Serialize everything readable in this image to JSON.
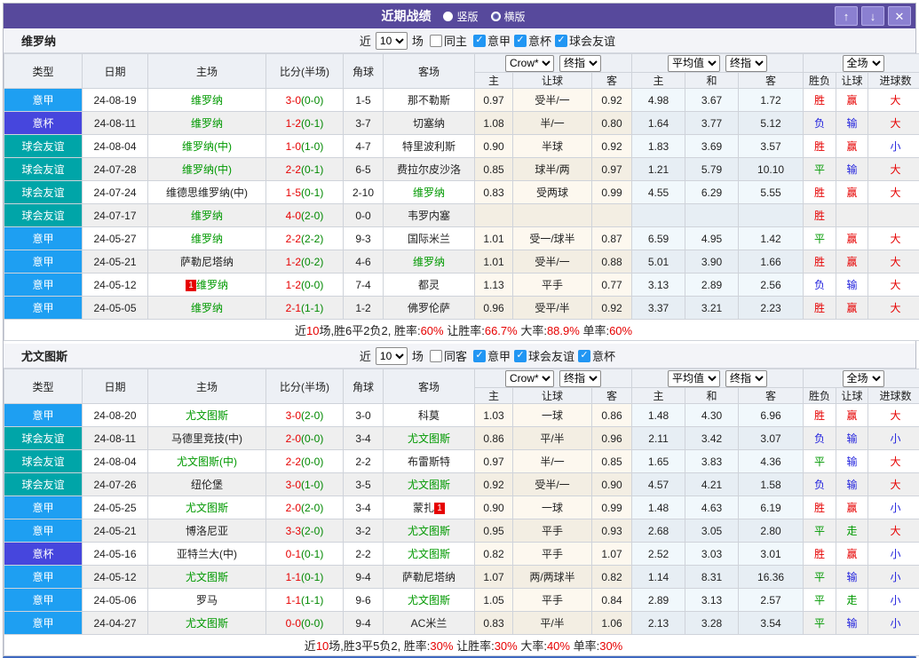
{
  "colors": {
    "league": {
      "意甲": "#1e9ff2",
      "意杯": "#4646dd",
      "球会友谊": "#00a5a8"
    },
    "result": {
      "r": "#e60000",
      "g": "#009900",
      "b": "#2323dd"
    },
    "titlebar": "#57499c",
    "team_highlight": "#009900",
    "score_fulltime": "#e60000",
    "score_halftime": "#008800",
    "checkbox_checked": "#2196f3"
  },
  "title_bar": {
    "title": "近期战绩",
    "view_options": [
      {
        "label": "竖版",
        "selected": true
      },
      {
        "label": "横版",
        "selected": false
      }
    ],
    "buttons": {
      "up": "↑",
      "down": "↓",
      "close": "✕"
    }
  },
  "columns": {
    "main": [
      "类型",
      "日期",
      "主场",
      "比分(半场)",
      "角球",
      "客场"
    ],
    "selects": [
      "Crow*",
      "终指",
      "平均值",
      "终指",
      "全场"
    ],
    "sub": [
      "主",
      "让球",
      "客",
      "主",
      "和",
      "客",
      "胜负",
      "让球",
      "进球数"
    ]
  },
  "sections": [
    {
      "team": "维罗纳",
      "filter": {
        "near_label": "近",
        "matches_value": "10",
        "matches_suffix": "场",
        "same_label": "同主",
        "same_checked": false,
        "leagues": [
          {
            "label": "意甲",
            "checked": true
          },
          {
            "label": "意杯",
            "checked": true
          },
          {
            "label": "球会友谊",
            "checked": true
          }
        ]
      },
      "rows": [
        {
          "type": "意甲",
          "date": "24-08-19",
          "home": {
            "t": "维罗纳",
            "hl": true
          },
          "score": {
            "ft": "3-0",
            "ht": "(0-0)"
          },
          "corner": "1-5",
          "away": {
            "t": "那不勒斯"
          },
          "odds": [
            "0.97",
            "受半/一",
            "0.92",
            "4.98",
            "3.67",
            "1.72"
          ],
          "res": [
            {
              "t": "胜",
              "c": "r"
            },
            {
              "t": "赢",
              "c": "r"
            },
            {
              "t": "大",
              "c": "r"
            }
          ]
        },
        {
          "type": "意杯",
          "date": "24-08-11",
          "home": {
            "t": "维罗纳",
            "hl": true
          },
          "score": {
            "ft": "1-2",
            "ht": "(0-1)"
          },
          "corner": "3-7",
          "away": {
            "t": "切塞纳"
          },
          "odds": [
            "1.08",
            "半/一",
            "0.80",
            "1.64",
            "3.77",
            "5.12"
          ],
          "res": [
            {
              "t": "负",
              "c": "b"
            },
            {
              "t": "输",
              "c": "b"
            },
            {
              "t": "大",
              "c": "r"
            }
          ]
        },
        {
          "type": "球会友谊",
          "date": "24-08-04",
          "home": {
            "t": "维罗纳(中)",
            "hl": true
          },
          "score": {
            "ft": "1-0",
            "ht": "(1-0)"
          },
          "corner": "4-7",
          "away": {
            "t": "特里波利斯"
          },
          "odds": [
            "0.90",
            "半球",
            "0.92",
            "1.83",
            "3.69",
            "3.57"
          ],
          "res": [
            {
              "t": "胜",
              "c": "r"
            },
            {
              "t": "赢",
              "c": "r"
            },
            {
              "t": "小",
              "c": "b"
            }
          ]
        },
        {
          "type": "球会友谊",
          "date": "24-07-28",
          "home": {
            "t": "维罗纳(中)",
            "hl": true
          },
          "score": {
            "ft": "2-2",
            "ht": "(0-1)"
          },
          "corner": "6-5",
          "away": {
            "t": "费拉尔皮沙洛"
          },
          "odds": [
            "0.85",
            "球半/两",
            "0.97",
            "1.21",
            "5.79",
            "10.10"
          ],
          "res": [
            {
              "t": "平",
              "c": "g"
            },
            {
              "t": "输",
              "c": "b"
            },
            {
              "t": "大",
              "c": "r"
            }
          ]
        },
        {
          "type": "球会友谊",
          "date": "24-07-24",
          "home": {
            "t": "维德思维罗纳(中)"
          },
          "score": {
            "ft": "1-5",
            "ht": "(0-1)"
          },
          "corner": "2-10",
          "away": {
            "t": "维罗纳",
            "hl": true
          },
          "odds": [
            "0.83",
            "受两球",
            "0.99",
            "4.55",
            "6.29",
            "5.55"
          ],
          "res": [
            {
              "t": "胜",
              "c": "r"
            },
            {
              "t": "赢",
              "c": "r"
            },
            {
              "t": "大",
              "c": "r"
            }
          ]
        },
        {
          "type": "球会友谊",
          "date": "24-07-17",
          "home": {
            "t": "维罗纳",
            "hl": true
          },
          "score": {
            "ft": "4-0",
            "ht": "(2-0)"
          },
          "corner": "0-0",
          "away": {
            "t": "韦罗内塞"
          },
          "odds": [
            "",
            "",
            "",
            "",
            "",
            ""
          ],
          "res": [
            {
              "t": "胜",
              "c": "r"
            },
            {
              "t": "",
              "c": ""
            },
            {
              "t": "",
              "c": ""
            }
          ]
        },
        {
          "type": "意甲",
          "date": "24-05-27",
          "home": {
            "t": "维罗纳",
            "hl": true
          },
          "score": {
            "ft": "2-2",
            "ht": "(2-2)"
          },
          "corner": "9-3",
          "away": {
            "t": "国际米兰"
          },
          "odds": [
            "1.01",
            "受一/球半",
            "0.87",
            "6.59",
            "4.95",
            "1.42"
          ],
          "res": [
            {
              "t": "平",
              "c": "g"
            },
            {
              "t": "赢",
              "c": "r"
            },
            {
              "t": "大",
              "c": "r"
            }
          ]
        },
        {
          "type": "意甲",
          "date": "24-05-21",
          "home": {
            "t": "萨勒尼塔纳"
          },
          "score": {
            "ft": "1-2",
            "ht": "(0-2)"
          },
          "corner": "4-6",
          "away": {
            "t": "维罗纳",
            "hl": true
          },
          "odds": [
            "1.01",
            "受半/一",
            "0.88",
            "5.01",
            "3.90",
            "1.66"
          ],
          "res": [
            {
              "t": "胜",
              "c": "r"
            },
            {
              "t": "赢",
              "c": "r"
            },
            {
              "t": "大",
              "c": "r"
            }
          ]
        },
        {
          "type": "意甲",
          "date": "24-05-12",
          "home": {
            "t": "维罗纳",
            "hl": true,
            "badge": "1",
            "badge_pos": "before"
          },
          "score": {
            "ft": "1-2",
            "ht": "(0-0)"
          },
          "corner": "7-4",
          "away": {
            "t": "都灵"
          },
          "odds": [
            "1.13",
            "平手",
            "0.77",
            "3.13",
            "2.89",
            "2.56"
          ],
          "res": [
            {
              "t": "负",
              "c": "b"
            },
            {
              "t": "输",
              "c": "b"
            },
            {
              "t": "大",
              "c": "r"
            }
          ]
        },
        {
          "type": "意甲",
          "date": "24-05-05",
          "home": {
            "t": "维罗纳",
            "hl": true
          },
          "score": {
            "ft": "2-1",
            "ht": "(1-1)"
          },
          "corner": "1-2",
          "away": {
            "t": "佛罗伦萨"
          },
          "odds": [
            "0.96",
            "受平/半",
            "0.92",
            "3.37",
            "3.21",
            "2.23"
          ],
          "res": [
            {
              "t": "胜",
              "c": "r"
            },
            {
              "t": "赢",
              "c": "r"
            },
            {
              "t": "大",
              "c": "r"
            }
          ]
        }
      ],
      "summary": [
        {
          "t": "近",
          "red": false
        },
        {
          "t": "10",
          "red": true
        },
        {
          "t": "场,胜6平2负2, 胜率:",
          "red": false
        },
        {
          "t": "60%",
          "red": true
        },
        {
          "t": " 让胜率:",
          "red": false
        },
        {
          "t": "66.7%",
          "red": true
        },
        {
          "t": " 大率:",
          "red": false
        },
        {
          "t": "88.9%",
          "red": true
        },
        {
          "t": " 单率:",
          "red": false
        },
        {
          "t": "60%",
          "red": true
        }
      ]
    },
    {
      "team": "尤文图斯",
      "filter": {
        "near_label": "近",
        "matches_value": "10",
        "matches_suffix": "场",
        "same_label": "同客",
        "same_checked": false,
        "leagues": [
          {
            "label": "意甲",
            "checked": true
          },
          {
            "label": "球会友谊",
            "checked": true
          },
          {
            "label": "意杯",
            "checked": true
          }
        ]
      },
      "rows": [
        {
          "type": "意甲",
          "date": "24-08-20",
          "home": {
            "t": "尤文图斯",
            "hl": true
          },
          "score": {
            "ft": "3-0",
            "ht": "(2-0)"
          },
          "corner": "3-0",
          "away": {
            "t": "科莫"
          },
          "odds": [
            "1.03",
            "一球",
            "0.86",
            "1.48",
            "4.30",
            "6.96"
          ],
          "res": [
            {
              "t": "胜",
              "c": "r"
            },
            {
              "t": "赢",
              "c": "r"
            },
            {
              "t": "大",
              "c": "r"
            }
          ]
        },
        {
          "type": "球会友谊",
          "date": "24-08-11",
          "home": {
            "t": "马德里竞技(中)"
          },
          "score": {
            "ft": "2-0",
            "ht": "(0-0)"
          },
          "corner": "3-4",
          "away": {
            "t": "尤文图斯",
            "hl": true
          },
          "odds": [
            "0.86",
            "平/半",
            "0.96",
            "2.11",
            "3.42",
            "3.07"
          ],
          "res": [
            {
              "t": "负",
              "c": "b"
            },
            {
              "t": "输",
              "c": "b"
            },
            {
              "t": "小",
              "c": "b"
            }
          ]
        },
        {
          "type": "球会友谊",
          "date": "24-08-04",
          "home": {
            "t": "尤文图斯(中)",
            "hl": true
          },
          "score": {
            "ft": "2-2",
            "ht": "(0-0)"
          },
          "corner": "2-2",
          "away": {
            "t": "布雷斯特"
          },
          "odds": [
            "0.97",
            "半/一",
            "0.85",
            "1.65",
            "3.83",
            "4.36"
          ],
          "res": [
            {
              "t": "平",
              "c": "g"
            },
            {
              "t": "输",
              "c": "b"
            },
            {
              "t": "大",
              "c": "r"
            }
          ]
        },
        {
          "type": "球会友谊",
          "date": "24-07-26",
          "home": {
            "t": "纽伦堡"
          },
          "score": {
            "ft": "3-0",
            "ht": "(1-0)"
          },
          "corner": "3-5",
          "away": {
            "t": "尤文图斯",
            "hl": true
          },
          "odds": [
            "0.92",
            "受半/一",
            "0.90",
            "4.57",
            "4.21",
            "1.58"
          ],
          "res": [
            {
              "t": "负",
              "c": "b"
            },
            {
              "t": "输",
              "c": "b"
            },
            {
              "t": "大",
              "c": "r"
            }
          ]
        },
        {
          "type": "意甲",
          "date": "24-05-25",
          "home": {
            "t": "尤文图斯",
            "hl": true
          },
          "score": {
            "ft": "2-0",
            "ht": "(2-0)"
          },
          "corner": "3-4",
          "away": {
            "t": "蒙扎",
            "badge": "1",
            "badge_pos": "after"
          },
          "odds": [
            "0.90",
            "一球",
            "0.99",
            "1.48",
            "4.63",
            "6.19"
          ],
          "res": [
            {
              "t": "胜",
              "c": "r"
            },
            {
              "t": "赢",
              "c": "r"
            },
            {
              "t": "小",
              "c": "b"
            }
          ]
        },
        {
          "type": "意甲",
          "date": "24-05-21",
          "home": {
            "t": "博洛尼亚"
          },
          "score": {
            "ft": "3-3",
            "ht": "(2-0)"
          },
          "corner": "3-2",
          "away": {
            "t": "尤文图斯",
            "hl": true
          },
          "odds": [
            "0.95",
            "平手",
            "0.93",
            "2.68",
            "3.05",
            "2.80"
          ],
          "res": [
            {
              "t": "平",
              "c": "g"
            },
            {
              "t": "走",
              "c": "g"
            },
            {
              "t": "大",
              "c": "r"
            }
          ]
        },
        {
          "type": "意杯",
          "date": "24-05-16",
          "home": {
            "t": "亚特兰大(中)"
          },
          "score": {
            "ft": "0-1",
            "ht": "(0-1)"
          },
          "corner": "2-2",
          "away": {
            "t": "尤文图斯",
            "hl": true
          },
          "odds": [
            "0.82",
            "平手",
            "1.07",
            "2.52",
            "3.03",
            "3.01"
          ],
          "res": [
            {
              "t": "胜",
              "c": "r"
            },
            {
              "t": "赢",
              "c": "r"
            },
            {
              "t": "小",
              "c": "b"
            }
          ]
        },
        {
          "type": "意甲",
          "date": "24-05-12",
          "home": {
            "t": "尤文图斯",
            "hl": true
          },
          "score": {
            "ft": "1-1",
            "ht": "(0-1)"
          },
          "corner": "9-4",
          "away": {
            "t": "萨勒尼塔纳"
          },
          "odds": [
            "1.07",
            "两/两球半",
            "0.82",
            "1.14",
            "8.31",
            "16.36"
          ],
          "res": [
            {
              "t": "平",
              "c": "g"
            },
            {
              "t": "输",
              "c": "b"
            },
            {
              "t": "小",
              "c": "b"
            }
          ]
        },
        {
          "type": "意甲",
          "date": "24-05-06",
          "home": {
            "t": "罗马"
          },
          "score": {
            "ft": "1-1",
            "ht": "(1-1)"
          },
          "corner": "9-6",
          "away": {
            "t": "尤文图斯",
            "hl": true
          },
          "odds": [
            "1.05",
            "平手",
            "0.84",
            "2.89",
            "3.13",
            "2.57"
          ],
          "res": [
            {
              "t": "平",
              "c": "g"
            },
            {
              "t": "走",
              "c": "g"
            },
            {
              "t": "小",
              "c": "b"
            }
          ]
        },
        {
          "type": "意甲",
          "date": "24-04-27",
          "home": {
            "t": "尤文图斯",
            "hl": true
          },
          "score": {
            "ft": "0-0",
            "ht": "(0-0)"
          },
          "corner": "9-4",
          "away": {
            "t": "AC米兰"
          },
          "odds": [
            "0.83",
            "平/半",
            "1.06",
            "2.13",
            "3.28",
            "3.54"
          ],
          "res": [
            {
              "t": "平",
              "c": "g"
            },
            {
              "t": "输",
              "c": "b"
            },
            {
              "t": "小",
              "c": "b"
            }
          ]
        }
      ],
      "summary": [
        {
          "t": "近",
          "red": false
        },
        {
          "t": "10",
          "red": true
        },
        {
          "t": "场,胜3平5负2, 胜率:",
          "red": false
        },
        {
          "t": "30%",
          "red": true
        },
        {
          "t": " 让胜率:",
          "red": false
        },
        {
          "t": "30%",
          "red": true
        },
        {
          "t": " 大率:",
          "red": false
        },
        {
          "t": "40%",
          "red": true
        },
        {
          "t": " 单率:",
          "red": false
        },
        {
          "t": "30%",
          "red": true
        }
      ]
    }
  ]
}
